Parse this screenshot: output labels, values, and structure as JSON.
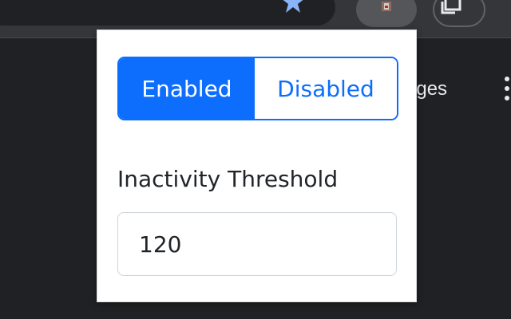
{
  "background": {
    "partial_link_text": "ages"
  },
  "toolbar": {
    "star_icon": "star-icon",
    "extension_icon": "extension-icon",
    "window_icon": "window-icon",
    "menu_icon": "kebab-menu-icon"
  },
  "popup": {
    "toggle": {
      "enabled_label": "Enabled",
      "disabled_label": "Disabled",
      "selected": "Enabled"
    },
    "threshold": {
      "label": "Inactivity Threshold",
      "value": "120"
    }
  },
  "colors": {
    "accent": "#0d6efd",
    "page_background": "#202124",
    "toolbar": "#35363a",
    "popup_background": "#ffffff",
    "text": "#212529",
    "input_border": "#ced4da"
  }
}
